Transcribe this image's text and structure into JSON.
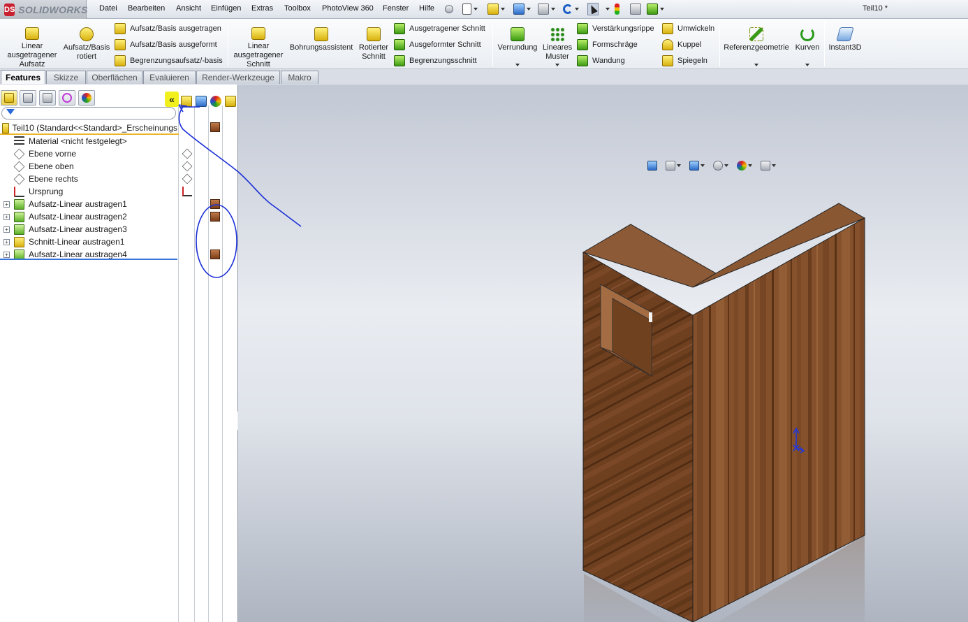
{
  "app": {
    "brand": "SOLIDWORKS",
    "logo_letters": "DS",
    "document_title": "Teil10 *"
  },
  "menu": [
    "Datei",
    "Bearbeiten",
    "Ansicht",
    "Einfügen",
    "Extras",
    "Toolbox",
    "PhotoView 360",
    "Fenster",
    "Hilfe"
  ],
  "ribbon": {
    "extrude_boss": "Linear ausgetragener Aufsatz",
    "revolve_boss": "Aufsatz/Basis rotiert",
    "sweep_boss": "Aufsatz/Basis ausgetragen",
    "loft_boss": "Aufsatz/Basis ausgeformt",
    "boundary_boss": "Begrenzungsaufsatz/-basis",
    "extrude_cut": "Linear ausgetragener Schnitt",
    "hole_wizard": "Bohrungsassistent",
    "revolve_cut": "Rotierter Schnitt",
    "sweep_cut": "Ausgetragener Schnitt",
    "loft_cut": "Ausgeformter Schnitt",
    "boundary_cut": "Begrenzungsschnitt",
    "fillet": "Verrundung",
    "linear_pattern": "Lineares Muster",
    "rib": "Verstärkungsrippe",
    "draft": "Formschräge",
    "shell": "Wandung",
    "wrap": "Umwickeln",
    "dome": "Kuppel",
    "mirror": "Spiegeln",
    "ref_geometry": "Referenzgeometrie",
    "curves": "Kurven",
    "instant3d": "Instant3D"
  },
  "tabs": [
    "Features",
    "Skizze",
    "Oberflächen",
    "Evaluieren",
    "Render-Werkzeuge",
    "Makro"
  ],
  "panel": {
    "collapse_glyph": "«",
    "root": "Teil10  (Standard<<Standard>_Erscheinungs",
    "items": [
      {
        "label": "Material <nicht festgelegt>",
        "type": "material",
        "expandable": false
      },
      {
        "label": "Ebene vorne",
        "type": "plane",
        "expandable": false
      },
      {
        "label": "Ebene oben",
        "type": "plane",
        "expandable": false
      },
      {
        "label": "Ebene rechts",
        "type": "plane",
        "expandable": false
      },
      {
        "label": "Ursprung",
        "type": "origin",
        "expandable": false
      },
      {
        "label": "Aufsatz-Linear austragen1",
        "type": "feat",
        "expandable": true
      },
      {
        "label": "Aufsatz-Linear austragen2",
        "type": "feat",
        "expandable": true
      },
      {
        "label": "Aufsatz-Linear austragen3",
        "type": "feat",
        "expandable": true
      },
      {
        "label": "Schnitt-Linear austragen1",
        "type": "cut",
        "expandable": true
      },
      {
        "label": "Aufsatz-Linear austragen4",
        "type": "feat",
        "expandable": true
      }
    ],
    "expand_glyph": "+"
  },
  "colors": {
    "annotation": "#1b2fd6",
    "wood_light": "#8a5530",
    "wood_dark": "#5c3318",
    "highlight": "#f2f01c"
  }
}
